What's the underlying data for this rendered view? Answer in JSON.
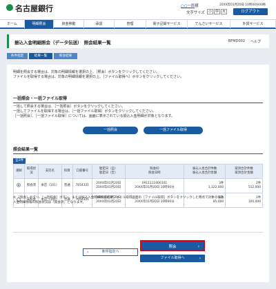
{
  "header": {
    "bank_name": "名古屋銀行",
    "user_name": "○○一郎",
    "user_suffix": "様",
    "last_login": "20XX年01月20日 10時00分00秒",
    "font_size_label": "文字サイズ",
    "font_small": "小",
    "font_medium": "中",
    "font_large": "大",
    "logout_label": "ログアウト"
  },
  "nav": {
    "items": [
      "ホーム",
      "明細照会",
      "資金移動",
      "承認",
      "管理",
      "電子記録サービス",
      "でんさいサービス",
      "外貨サービス"
    ],
    "active_index": 1
  },
  "page": {
    "title": "振込入金明細照会（データ伝送）　照会結果一覧",
    "code": "BFMD002",
    "help": "ヘルプ"
  },
  "steps": [
    "条件指定",
    "結果一覧",
    "照会結果"
  ],
  "intro": {
    "line1": "明細を照会する場合は、対象の明細情報を選択の上、［照会］ボタンをクリックしてください。",
    "line2": "ファイルを取得する場合は、対象の明細情報を選択の上、［ファイル取得へ］ボタンをクリックしてください。"
  },
  "bulk": {
    "heading": "一括照会・一括ファイル取得",
    "line1": "一括して照会する場合は、［一括照会］ボタンをクリックしてください。",
    "line2": "一括してファイルを取得する場合は、［一括ファイル取得］ボタンをクリックしてください。",
    "line3": "［一括照会］、［一括ファイル取得］については、画面に表示されている振込入金明細が対象となります。",
    "bulk_inquiry": "一括照会",
    "bulk_file": "一括ファイル取得"
  },
  "results": {
    "heading": "照会結果一覧",
    "count": "全2件",
    "columns": [
      "選択",
      "取得状況",
      "支店名",
      "科目",
      "口座番号",
      "勘定日（自）",
      "勘定日（至）",
      "照会ID",
      "照会日時",
      "振込入金合計件数",
      "振込入金合計金額",
      "取消合計件数",
      "取消合計金額"
    ],
    "rows": [
      {
        "status": "照会済",
        "branch": "本店（101）",
        "subject": "普通",
        "account": "7654321",
        "from": "20XX年01月20日",
        "to": "20XX年01月20日",
        "id": "0911111000101",
        "datetime": "20XX年01月20日 10時00分",
        "count": "3件",
        "amount": "1,122,000",
        "cancel_count": "2件",
        "cancel_amount": "512,000",
        "selected": true
      },
      {
        "status": "未照会",
        "branch": "本店（101）",
        "subject": "普通",
        "account": "7654321",
        "from": "20XX年01月20日",
        "to": "20XX年01月20日",
        "id": "－",
        "datetime": "20XX年01月20日 10時00分",
        "count": "1件",
        "amount": "85,000",
        "cancel_count": "1件",
        "cancel_amount": "100,000",
        "selected": false
      }
    ]
  },
  "note": {
    "line1": "※ ［照会］ボタン、［一括照会］ボタン、または振込入金明細照会結果ファイル取得画面の［ファイル取得］ボタンをクリックした時点で対象の振込",
    "line2": "入金明細情報の照会状況は「照会済」となります。"
  },
  "buttons": {
    "back": "条件指定へ",
    "ok": "照会",
    "file": "ファイル取得へ"
  }
}
